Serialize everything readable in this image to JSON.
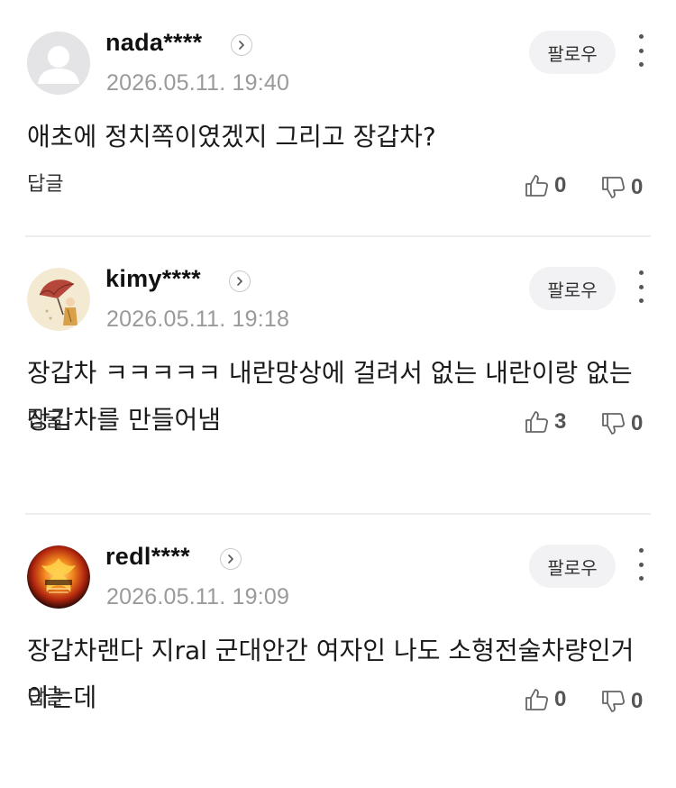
{
  "comments": [
    {
      "username": "nada****",
      "timestamp": "2026.05.11. 19:40",
      "follow_label": "팔로우",
      "body": "애초에 정치쪽이였겠지 그리고 장갑차?",
      "reply_label": "답글",
      "likes": "0",
      "dislikes": "0",
      "avatar": "default-person-icon"
    },
    {
      "username": "kimy****",
      "timestamp": "2026.05.11. 19:18",
      "follow_label": "팔로우",
      "body": "장갑차 ㅋㅋㅋㅋㅋ 내란망상에 걸려서 없는 내란이랑 없는 장갑차를 만들어냄",
      "reply_label": "답글",
      "likes": "3",
      "dislikes": "0",
      "avatar": "illustration-umbrella"
    },
    {
      "username": "redl****",
      "timestamp": "2026.05.11. 19:09",
      "follow_label": "팔로우",
      "body": "장갑차랜다 지ral 군대안간 여자인 나도 소형전술차량인거 아는데",
      "reply_label": "답글",
      "likes": "0",
      "dislikes": "0",
      "avatar": "phoenix-fire"
    }
  ],
  "colors": {
    "text_primary": "#1a1a1a",
    "text_secondary": "#9a9a9a",
    "follow_bg": "#f2f2f4",
    "divider": "#eeeeee"
  }
}
